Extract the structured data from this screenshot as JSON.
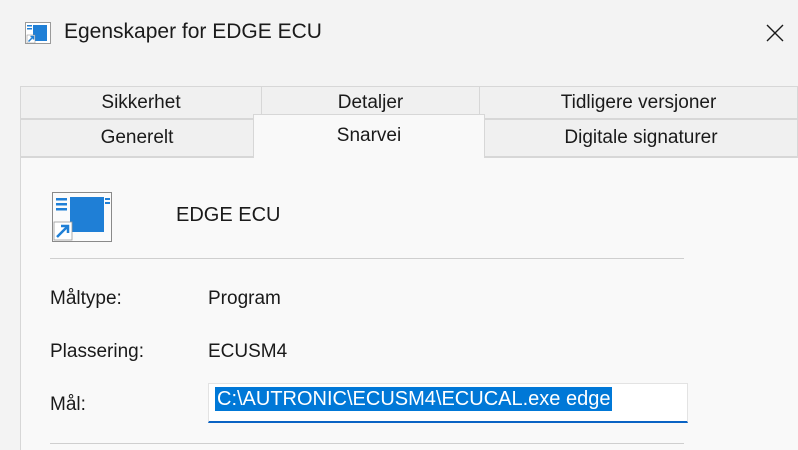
{
  "window": {
    "title": "Egenskaper for EDGE ECU",
    "close_glyph": "✕"
  },
  "tabs": {
    "back_row": [
      {
        "label": "Sikkerhet"
      },
      {
        "label": "Detaljer"
      },
      {
        "label": "Tidligere versjoner"
      }
    ],
    "front_row": [
      {
        "label": "Generelt"
      },
      {
        "label": "Snarvei",
        "active": true
      },
      {
        "label": "Digitale signaturer"
      }
    ]
  },
  "shortcut": {
    "app_name": "EDGE ECU",
    "icon": "application-shortcut-icon",
    "fields": {
      "target_type_label": "Måltype:",
      "target_type_value": "Program",
      "location_label": "Plassering:",
      "location_value": "ECUSM4",
      "target_label": "Mål:",
      "target_value": "C:\\AUTRONIC\\ECUSM4\\ECUCAL.exe edge"
    }
  },
  "colors": {
    "accent": "#0078d7",
    "icon_blue": "#1f7fd6"
  }
}
